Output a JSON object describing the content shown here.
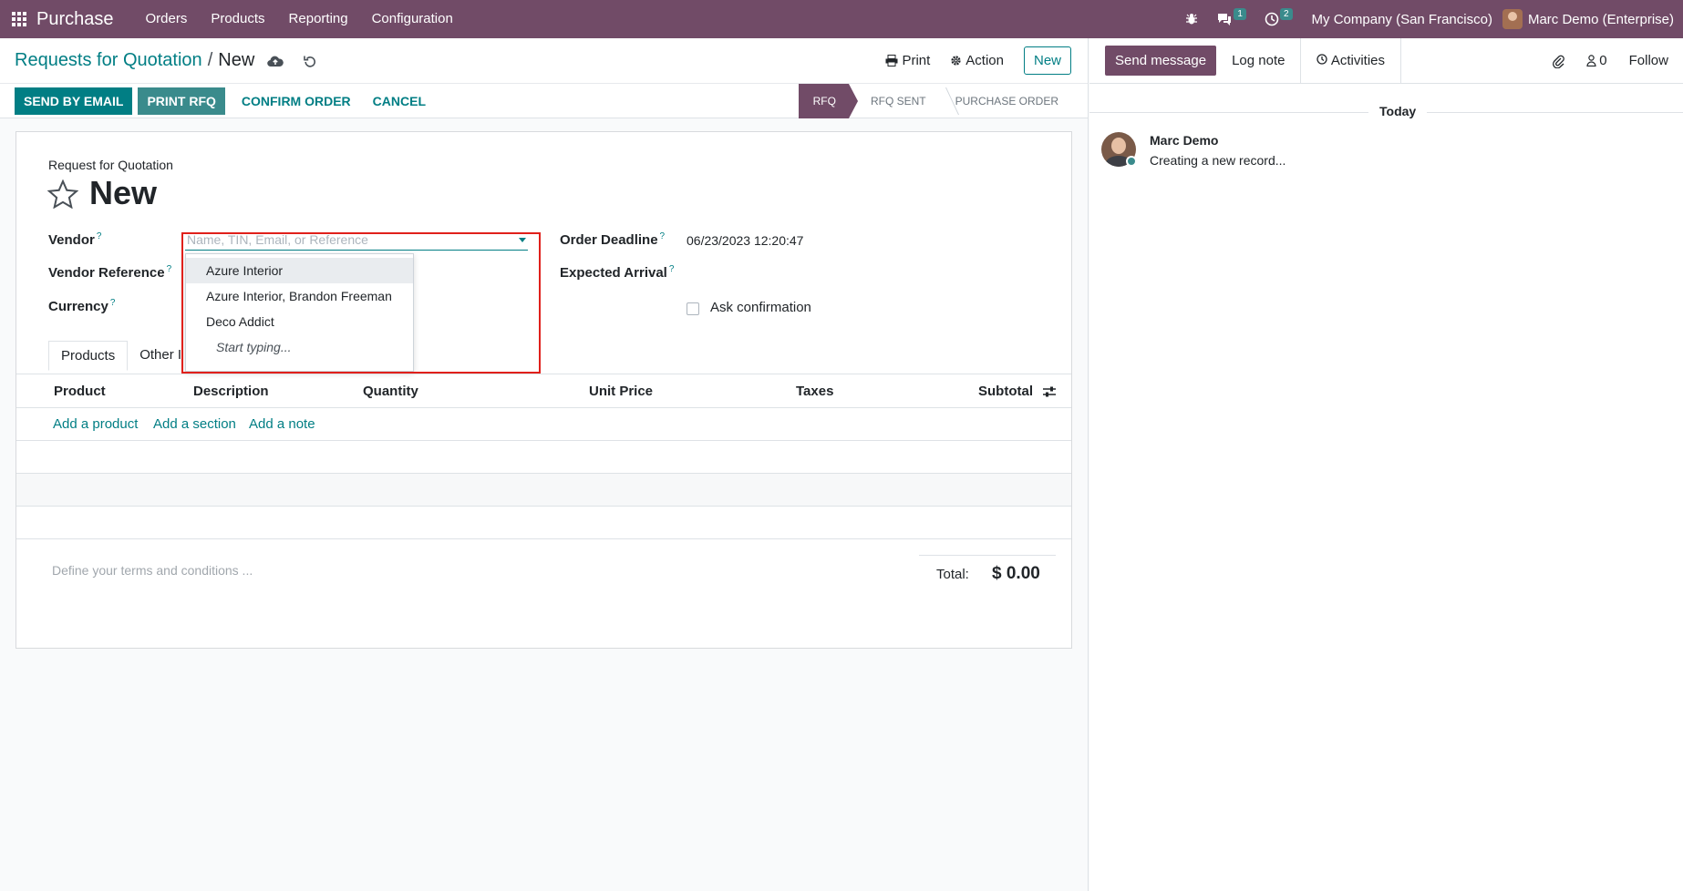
{
  "navbar": {
    "brand": "Purchase",
    "menu": [
      "Orders",
      "Products",
      "Reporting",
      "Configuration"
    ],
    "messages_count": "1",
    "activities_count": "2",
    "company": "My Company (San Francisco)",
    "user": "Marc Demo (Enterprise)"
  },
  "control_panel": {
    "breadcrumb_parent": "Requests for Quotation",
    "breadcrumb_sep": "/",
    "breadcrumb_current": "New",
    "print": "Print",
    "action": "Action",
    "new_button": "New"
  },
  "statusbar": {
    "buttons": [
      "SEND BY EMAIL",
      "PRINT RFQ",
      "CONFIRM ORDER",
      "CANCEL"
    ],
    "stages": [
      "RFQ",
      "RFQ SENT",
      "PURCHASE ORDER"
    ],
    "active_stage": "RFQ"
  },
  "form": {
    "record_label": "Request for Quotation",
    "title": "New",
    "vendor_label": "Vendor",
    "vendor_placeholder": "Name, TIN, Email, or Reference",
    "vendor_reference_label": "Vendor Reference",
    "currency_label": "Currency",
    "order_deadline_label": "Order Deadline",
    "order_deadline_value": "06/23/2023 12:20:47",
    "expected_arrival_label": "Expected Arrival",
    "ask_confirmation_label": "Ask confirmation",
    "help_mark": "?",
    "vendor_dropdown": [
      "Azure Interior",
      "Azure Interior, Brandon Freeman",
      "Deco Addict"
    ],
    "vendor_dropdown_hint": "Start typing..."
  },
  "tabs": [
    "Products",
    "Other I"
  ],
  "table": {
    "columns": [
      "Product",
      "Description",
      "Quantity",
      "Unit Price",
      "Taxes",
      "Subtotal"
    ],
    "add_links": [
      "Add a product",
      "Add a section",
      "Add a note"
    ]
  },
  "footer": {
    "terms_placeholder": "Define your terms and conditions ...",
    "total_label": "Total:",
    "total_value": "$ 0.00"
  },
  "chatter": {
    "send_message": "Send message",
    "log_note": "Log note",
    "activities": "Activities",
    "followers_count": "0",
    "follow": "Follow",
    "date_separator": "Today",
    "message_author": "Marc Demo",
    "message_body": "Creating a new record..."
  }
}
